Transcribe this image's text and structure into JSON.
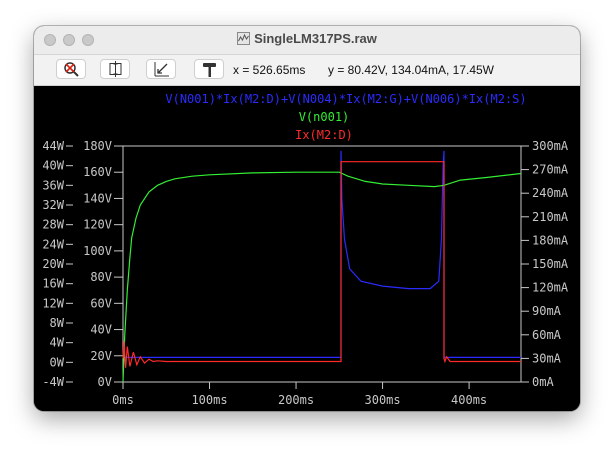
{
  "window": {
    "title": "SingleLM317PS.raw",
    "colors": {
      "blue": "#2b2bff",
      "green": "#33ee33",
      "red": "#ff2a2a",
      "axis": "#c8c8c8"
    }
  },
  "toolbar": {
    "buttons": [
      {
        "name": "autorange-button",
        "icon": "magnifier-cross-icon"
      },
      {
        "name": "zoom-extent-button",
        "icon": "zoom-extent-icon"
      },
      {
        "name": "zoom-back-button",
        "icon": "zoom-back-icon"
      },
      {
        "name": "probe-button",
        "icon": "probe-hammer-icon"
      }
    ],
    "cursor_x": "x = 526.65ms",
    "cursor_y": "y = 80.42V, 134.04mA, 17.45W"
  },
  "plot": {
    "traces": {
      "power": "V(N001)*Ix(M2:D)+V(N004)*Ix(M2:G)+V(N006)*Ix(M2:S)",
      "voltage": "V(n001)",
      "current": "Ix(M2:D)"
    },
    "x_ticks": [
      "0ms",
      "100ms",
      "200ms",
      "300ms",
      "400ms"
    ],
    "watt_ticks": [
      "44W",
      "40W",
      "36W",
      "32W",
      "28W",
      "24W",
      "20W",
      "16W",
      "12W",
      "8W",
      "4W",
      "0W",
      "-4W"
    ],
    "volt_ticks": [
      "180V",
      "160V",
      "140V",
      "120V",
      "100V",
      "80V",
      "60V",
      "40V",
      "20V",
      "0V"
    ],
    "amp_ticks": [
      "300mA",
      "270mA",
      "240mA",
      "210mA",
      "180mA",
      "150mA",
      "120mA",
      "90mA",
      "60mA",
      "30mA",
      "0mA"
    ]
  },
  "chart_data": {
    "type": "line",
    "x_unit": "ms",
    "xlim": [
      0,
      460
    ],
    "y_left_inner": {
      "unit": "V",
      "range": [
        0,
        180
      ]
    },
    "y_left_outer": {
      "unit": "W",
      "range": [
        -4,
        44
      ]
    },
    "y_right": {
      "unit": "mA",
      "range": [
        0,
        300
      ]
    },
    "series": [
      {
        "name": "V(N001)*Ix(M2:D)+V(N004)*Ix(M2:G)+V(N006)*Ix(M2:S)",
        "axis": "W",
        "x": [
          0,
          100,
          200,
          252,
          252,
          253,
          256,
          262,
          275,
          300,
          330,
          355,
          365,
          368,
          370,
          371,
          371,
          400,
          460
        ],
        "y": [
          1,
          1,
          1,
          1,
          43,
          33,
          25,
          19,
          16.5,
          15.5,
          15,
          15,
          16.5,
          25,
          40,
          43,
          1,
          1,
          1
        ]
      },
      {
        "name": "V(n001)",
        "axis": "V",
        "x": [
          0,
          2,
          5,
          8,
          10,
          15,
          20,
          30,
          40,
          50,
          60,
          80,
          100,
          150,
          200,
          250,
          260,
          280,
          300,
          330,
          360,
          371,
          390,
          420,
          460
        ],
        "y": [
          0,
          35,
          70,
          95,
          110,
          125,
          135,
          145,
          150,
          153,
          155,
          157,
          158,
          159.5,
          160,
          160,
          157,
          153,
          151,
          150,
          149,
          150,
          154,
          156,
          159
        ]
      },
      {
        "name": "Ix(M2:D)",
        "axis": "mA",
        "x": [
          0,
          1,
          3,
          5,
          8,
          12,
          16,
          20,
          25,
          30,
          35,
          40,
          50,
          100,
          200,
          252,
          252,
          253,
          300,
          365,
          371,
          371,
          372,
          374,
          378,
          400,
          460
        ],
        "y": [
          30,
          52,
          18,
          45,
          20,
          38,
          22,
          32,
          24,
          29,
          26,
          27,
          26,
          26,
          26,
          26,
          280,
          280,
          280,
          280,
          280,
          30,
          26,
          32,
          26,
          26,
          26
        ]
      }
    ]
  }
}
